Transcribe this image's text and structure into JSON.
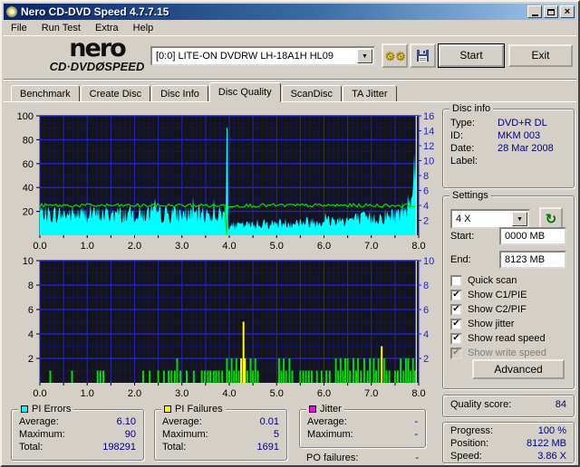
{
  "window": {
    "title": "Nero CD-DVD Speed 4.7.7.15"
  },
  "menu": {
    "items": [
      "File",
      "Run Test",
      "Extra",
      "Help"
    ]
  },
  "toolbar": {
    "brand_top": "nero",
    "brand_bottom": "CD·DVDØSPEED",
    "drive": "[0:0]   LITE-ON DVDRW LH-18A1H HL09",
    "start_label": "Start",
    "exit_label": "Exit"
  },
  "tabs": {
    "items": [
      "Benchmark",
      "Create Disc",
      "Disc Info",
      "Disc Quality",
      "ScanDisc",
      "TA Jitter"
    ],
    "active": "Disc Quality"
  },
  "disc_info": {
    "title": "Disc info",
    "rows": [
      {
        "label": "Type:",
        "value": "DVD+R DL"
      },
      {
        "label": "ID:",
        "value": "MKM 003"
      },
      {
        "label": "Date:",
        "value": "28 Mar 2008"
      },
      {
        "label": "Label:",
        "value": ""
      }
    ]
  },
  "settings": {
    "title": "Settings",
    "speed": "4 X",
    "start_label": "Start:",
    "start_value": "0000 MB",
    "end_label": "End:",
    "end_value": "8123 MB",
    "checkboxes": [
      {
        "label": "Quick scan",
        "checked": false,
        "disabled": false
      },
      {
        "label": "Show C1/PIE",
        "checked": true,
        "disabled": false
      },
      {
        "label": "Show C2/PIF",
        "checked": true,
        "disabled": false
      },
      {
        "label": "Show jitter",
        "checked": true,
        "disabled": false
      },
      {
        "label": "Show read speed",
        "checked": true,
        "disabled": false
      },
      {
        "label": "Show write speed",
        "checked": true,
        "disabled": true
      }
    ],
    "advanced_label": "Advanced"
  },
  "quality": {
    "label": "Quality score:",
    "value": "84"
  },
  "progress": {
    "rows": [
      {
        "label": "Progress:",
        "value": "100 %"
      },
      {
        "label": "Position:",
        "value": "8122 MB"
      },
      {
        "label": "Speed:",
        "value": "3.86 X"
      }
    ]
  },
  "stats": {
    "pi_errors": {
      "title": "PI Errors",
      "color": "#00ffff",
      "rows": [
        {
          "label": "Average:",
          "value": "6.10"
        },
        {
          "label": "Maximum:",
          "value": "90"
        },
        {
          "label": "Total:",
          "value": "198291"
        }
      ]
    },
    "pi_failures": {
      "title": "PI Failures",
      "color": "#ffff00",
      "rows": [
        {
          "label": "Average:",
          "value": "0.01"
        },
        {
          "label": "Maximum:",
          "value": "5"
        },
        {
          "label": "Total:",
          "value": "1691"
        }
      ]
    },
    "jitter": {
      "title": "Jitter",
      "color": "#ff00ff",
      "rows": [
        {
          "label": "Average:",
          "value": "-"
        },
        {
          "label": "Maximum:",
          "value": "-"
        }
      ]
    },
    "po_failures": {
      "label": "PO failures:",
      "value": "-"
    }
  },
  "chart_data": [
    {
      "type": "area",
      "name": "pi-errors-scan",
      "x_range": [
        0,
        8
      ],
      "x_tick_step": 1,
      "x_tick_labels": [
        "0.0",
        "1.0",
        "2.0",
        "3.0",
        "4.0",
        "5.0",
        "6.0",
        "7.0",
        "8.0"
      ],
      "y_left": {
        "range": [
          0,
          100
        ],
        "major": 20,
        "minor": 10,
        "ticks": [
          20,
          40,
          60,
          80,
          100
        ]
      },
      "y_right": {
        "range": [
          0,
          16
        ],
        "major": 2,
        "ticks": [
          2,
          4,
          6,
          8,
          10,
          12,
          14,
          16
        ]
      },
      "grid": {
        "x_major": 0.5,
        "x_minor": 0.1
      },
      "colors": {
        "bg": "#151515",
        "grid_major": "#2222c8",
        "grid_minor": "#12125e",
        "area": "#00ffff",
        "line": "#00dd00",
        "cursor": "#d8d8d8",
        "right_axis_text": "#2222c8"
      },
      "series": [
        {
          "name": "pi_errors",
          "color": "#00ffff",
          "noise_seed": 7,
          "noise": 0.5,
          "envelope": [
            [
              0,
              16
            ],
            [
              3.9,
              16
            ],
            [
              4.0,
              7
            ],
            [
              4.5,
              8
            ],
            [
              5.0,
              9
            ],
            [
              5.5,
              10
            ],
            [
              6.0,
              11
            ],
            [
              6.5,
              12
            ],
            [
              7.0,
              13
            ],
            [
              7.4,
              15
            ],
            [
              7.6,
              17
            ],
            [
              7.75,
              24
            ],
            [
              7.82,
              33
            ],
            [
              7.88,
              45
            ],
            [
              7.95,
              53
            ]
          ],
          "spike": {
            "x": 3.95,
            "value": 90,
            "width": 0.022
          }
        },
        {
          "name": "read_speed",
          "axis": "right",
          "color": "#00dd00",
          "value": 4,
          "dip": {
            "x": 3.95,
            "width": 0.03
          }
        }
      ],
      "cursor_x": 7.95
    },
    {
      "type": "bar",
      "name": "pi-failures-scan",
      "x_range": [
        0,
        8
      ],
      "x_tick_step": 1,
      "x_tick_labels": [
        "0.0",
        "1.0",
        "2.0",
        "3.0",
        "4.0",
        "5.0",
        "6.0",
        "7.0",
        "8.0"
      ],
      "y": {
        "range": [
          0,
          10
        ],
        "major": 2,
        "minor": 1,
        "ticks": [
          2,
          4,
          6,
          8,
          10
        ]
      },
      "grid": {
        "x_major": 0.5,
        "x_minor": 0.1
      },
      "colors": {
        "bg": "#151515",
        "grid_major": "#2222c8",
        "grid_minor": "#12125e",
        "g": "#00dd00",
        "y": "#ffff00",
        "cursor": "#d8d8d8",
        "right_axis_text": "#2222c8"
      },
      "bars": [
        [
          0.22,
          1,
          "g"
        ],
        [
          0.68,
          1,
          "g"
        ],
        [
          1.22,
          1,
          "g"
        ],
        [
          1.28,
          1,
          "g"
        ],
        [
          1.34,
          1,
          "g"
        ],
        [
          2.18,
          1,
          "g"
        ],
        [
          2.32,
          1,
          "g"
        ],
        [
          2.5,
          1,
          "g"
        ],
        [
          2.62,
          1,
          "g"
        ],
        [
          2.72,
          1,
          "g"
        ],
        [
          2.78,
          1,
          "g"
        ],
        [
          2.85,
          1,
          "g"
        ],
        [
          2.9,
          2,
          "g"
        ],
        [
          2.97,
          1,
          "g"
        ],
        [
          3.1,
          1,
          "g"
        ],
        [
          3.25,
          1,
          "g"
        ],
        [
          3.42,
          1,
          "g"
        ],
        [
          3.48,
          1,
          "g"
        ],
        [
          3.55,
          1,
          "g"
        ],
        [
          3.6,
          1,
          "g"
        ],
        [
          3.67,
          1,
          "g"
        ],
        [
          3.72,
          1,
          "g"
        ],
        [
          3.78,
          1,
          "g"
        ],
        [
          3.85,
          1,
          "g"
        ],
        [
          3.95,
          2,
          "g"
        ],
        [
          4.0,
          1,
          "g"
        ],
        [
          4.05,
          2,
          "g"
        ],
        [
          4.1,
          1,
          "g"
        ],
        [
          4.15,
          2,
          "g"
        ],
        [
          4.2,
          1,
          "g"
        ],
        [
          4.25,
          2,
          "y"
        ],
        [
          4.3,
          5,
          "y"
        ],
        [
          4.33,
          2,
          "y"
        ],
        [
          4.38,
          1,
          "g"
        ],
        [
          4.45,
          2,
          "g"
        ],
        [
          4.5,
          1,
          "g"
        ],
        [
          4.55,
          2,
          "g"
        ],
        [
          4.6,
          1,
          "g"
        ],
        [
          5.05,
          2,
          "g"
        ],
        [
          5.1,
          1,
          "g"
        ],
        [
          5.15,
          2,
          "g"
        ],
        [
          5.2,
          1,
          "g"
        ],
        [
          5.27,
          2,
          "g"
        ],
        [
          5.33,
          1,
          "g"
        ],
        [
          5.5,
          1,
          "g"
        ],
        [
          5.56,
          1,
          "g"
        ],
        [
          5.62,
          1,
          "g"
        ],
        [
          5.68,
          1,
          "g"
        ],
        [
          5.74,
          1,
          "g"
        ],
        [
          5.85,
          1,
          "g"
        ],
        [
          5.95,
          1,
          "g"
        ],
        [
          6.05,
          1,
          "g"
        ],
        [
          6.12,
          1,
          "g"
        ],
        [
          6.25,
          2,
          "g"
        ],
        [
          6.3,
          1,
          "g"
        ],
        [
          6.35,
          2,
          "g"
        ],
        [
          6.4,
          1,
          "g"
        ],
        [
          6.45,
          2,
          "g"
        ],
        [
          6.5,
          2,
          "g"
        ],
        [
          6.55,
          1,
          "g"
        ],
        [
          6.62,
          2,
          "g"
        ],
        [
          6.68,
          1,
          "g"
        ],
        [
          6.72,
          2,
          "g"
        ],
        [
          6.78,
          1,
          "g"
        ],
        [
          6.85,
          2,
          "g"
        ],
        [
          6.92,
          1,
          "g"
        ],
        [
          6.97,
          2,
          "g"
        ],
        [
          7.05,
          2,
          "g"
        ],
        [
          7.1,
          1,
          "g"
        ],
        [
          7.15,
          2,
          "g"
        ],
        [
          7.22,
          3,
          "y"
        ],
        [
          7.27,
          2,
          "g"
        ],
        [
          7.32,
          1,
          "g"
        ],
        [
          7.38,
          1,
          "g"
        ],
        [
          7.5,
          1,
          "g"
        ],
        [
          7.56,
          1,
          "g"
        ],
        [
          7.62,
          2,
          "g"
        ],
        [
          7.68,
          1,
          "g"
        ],
        [
          7.73,
          2,
          "g"
        ],
        [
          7.78,
          2,
          "g"
        ],
        [
          7.83,
          1,
          "g"
        ],
        [
          7.88,
          2,
          "g"
        ],
        [
          7.92,
          1,
          "g"
        ]
      ],
      "cursor_x": 7.95
    }
  ]
}
